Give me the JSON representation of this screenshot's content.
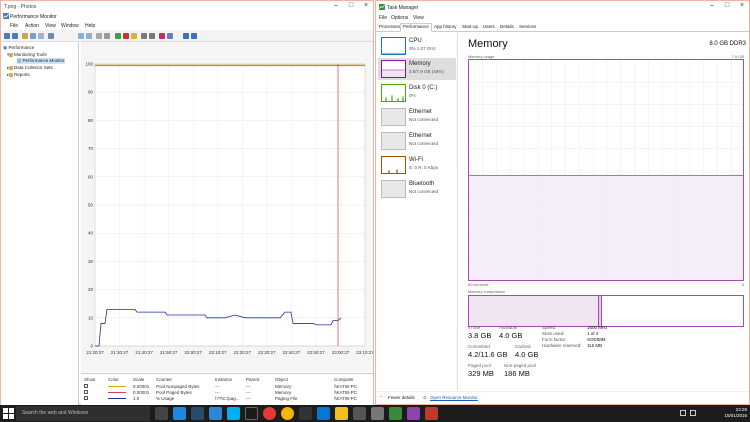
{
  "left_window": {
    "title": "T.png - Photos",
    "app_title": "Performance Monitor",
    "menu": [
      "File",
      "Action",
      "View",
      "Window",
      "Help"
    ],
    "tree": [
      {
        "label": "Performance",
        "level": 0
      },
      {
        "label": "Monitoring Tools",
        "level": 1
      },
      {
        "label": "Performance Monitor",
        "level": 2
      },
      {
        "label": "Data Collector Sets",
        "level": 1
      },
      {
        "label": "Reports",
        "level": 1
      }
    ],
    "chart": {
      "y_ticks": [
        "100",
        "90",
        "80",
        "70",
        "60",
        "50",
        "40",
        "30",
        "20",
        "10",
        "0"
      ],
      "x_ticks": [
        "21:20:27",
        "21:30:27",
        "21:40:27",
        "21:50:27",
        "22:00:27",
        "22:10:27",
        "22:20:27",
        "22:30:27",
        "22:40:27",
        "22:50:27",
        "23:00:27",
        "23:10:27"
      ]
    },
    "counters": {
      "headers": [
        "Show",
        "Color",
        "Scale",
        "Counter",
        "Instance",
        "Parent",
        "Object",
        "Computer"
      ],
      "rows": [
        {
          "scale": "0.00001",
          "counter": "Pool Nonpaged Bytes",
          "instance": "---",
          "parent": "---",
          "object": "Memory",
          "computer": "\\\\KATIB-PC",
          "color": "#c8b400"
        },
        {
          "scale": "0.00001",
          "counter": "Pool Paged Bytes",
          "instance": "---",
          "parent": "---",
          "object": "Memory",
          "computer": "\\\\KATIB-PC",
          "color": "#d04070"
        },
        {
          "scale": "1.0",
          "counter": "% Usage",
          "instance": "\\??\\C:\\pag...",
          "parent": "---",
          "object": "Paging File",
          "computer": "\\\\KATIB-PC",
          "color": "#2030a0"
        }
      ]
    }
  },
  "task_manager": {
    "title": "Task Manager",
    "menu": [
      "File",
      "Options",
      "View"
    ],
    "tabs": [
      "Processes",
      "Performance",
      "App history",
      "Start-up",
      "Users",
      "Details",
      "Services"
    ],
    "active_tab": 1,
    "resources": [
      {
        "name": "CPU",
        "sub": "3% 1.07 GHz",
        "color": "#117dbb"
      },
      {
        "name": "Memory",
        "sub": "3.8/7.9 GB (48%)",
        "color": "#8b12ae"
      },
      {
        "name": "Disk 0 (C:)",
        "sub": "0%",
        "color": "#4da60c"
      },
      {
        "name": "Ethernet",
        "sub": "Not connected",
        "color": "#a74f01"
      },
      {
        "name": "Ethernet",
        "sub": "Not connected",
        "color": "#a74f01"
      },
      {
        "name": "Wi-Fi",
        "sub": "S: 0 R: 0 Kbps",
        "color": "#a74f01"
      },
      {
        "name": "Bluetooth",
        "sub": "Not connected",
        "color": "#a74f01"
      }
    ],
    "main": {
      "title": "Memory",
      "total": "8.0 GB DDR3",
      "usage_label": "Memory usage",
      "usage_max": "7.9 GB",
      "time_left": "60 seconds",
      "time_right": "0",
      "composition_label": "Memory composition",
      "usage_fraction": 0.48,
      "stats": [
        {
          "label": "In use",
          "value": "3.8 GB"
        },
        {
          "label": "Available",
          "value": "4.0 GB"
        },
        {
          "label": "Committed",
          "value": "4.2/11.6 GB"
        },
        {
          "label": "Cached",
          "value": "4.0 GB"
        },
        {
          "label": "Paged pool",
          "value": "329 MB"
        },
        {
          "label": "Non-paged pool",
          "value": "186 MB"
        }
      ],
      "specs": [
        {
          "label": "Speed:",
          "value": "1600 MHz"
        },
        {
          "label": "Slots used:",
          "value": "1 of 4"
        },
        {
          "label": "Form factor:",
          "value": "SODIMM"
        },
        {
          "label": "Hardware reserved:",
          "value": "116 MB"
        }
      ]
    },
    "footer": {
      "fewer": "Fewer details",
      "resmon": "Open Resource Monitor"
    }
  },
  "taskbar": {
    "search_placeholder": "Search the web and Windows",
    "time": "23:28",
    "date": "15/01/2016"
  }
}
